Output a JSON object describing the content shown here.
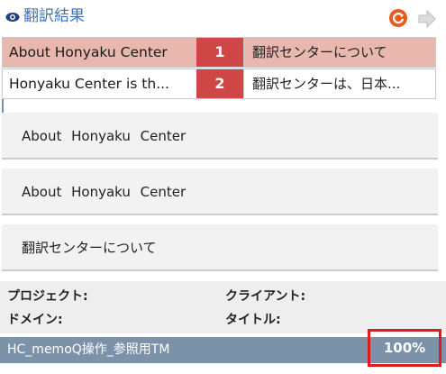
{
  "header": {
    "title": "翻訳結果"
  },
  "segments": [
    {
      "source": "About Honyaku Center",
      "index": "1",
      "target": "翻訳センターについて"
    },
    {
      "source": "Honyaku Center is th...",
      "index": "2",
      "target": "翻訳センターは、日本..."
    }
  ],
  "details": {
    "source_text": "About Honyaku Center",
    "compare_text": "About Honyaku Center",
    "target_text": "翻訳センターについて"
  },
  "meta": {
    "project_label": "プロジェクト:",
    "client_label": "クライアント:",
    "domain_label": "ドメイン:",
    "title_label": "タイトル:"
  },
  "tm": {
    "name": "HC_memoQ操作_参照用TM",
    "match": "100%"
  },
  "colors": {
    "accent": "#3d73b5",
    "selected_row": "#e8b8ae",
    "index_badge": "#cf4646",
    "tm_bar": "#7b92a8",
    "highlight_box": "#e01b1b"
  },
  "icons": {
    "header": "eye-icon",
    "refresh": "refresh-icon",
    "next": "arrow-right-icon"
  }
}
